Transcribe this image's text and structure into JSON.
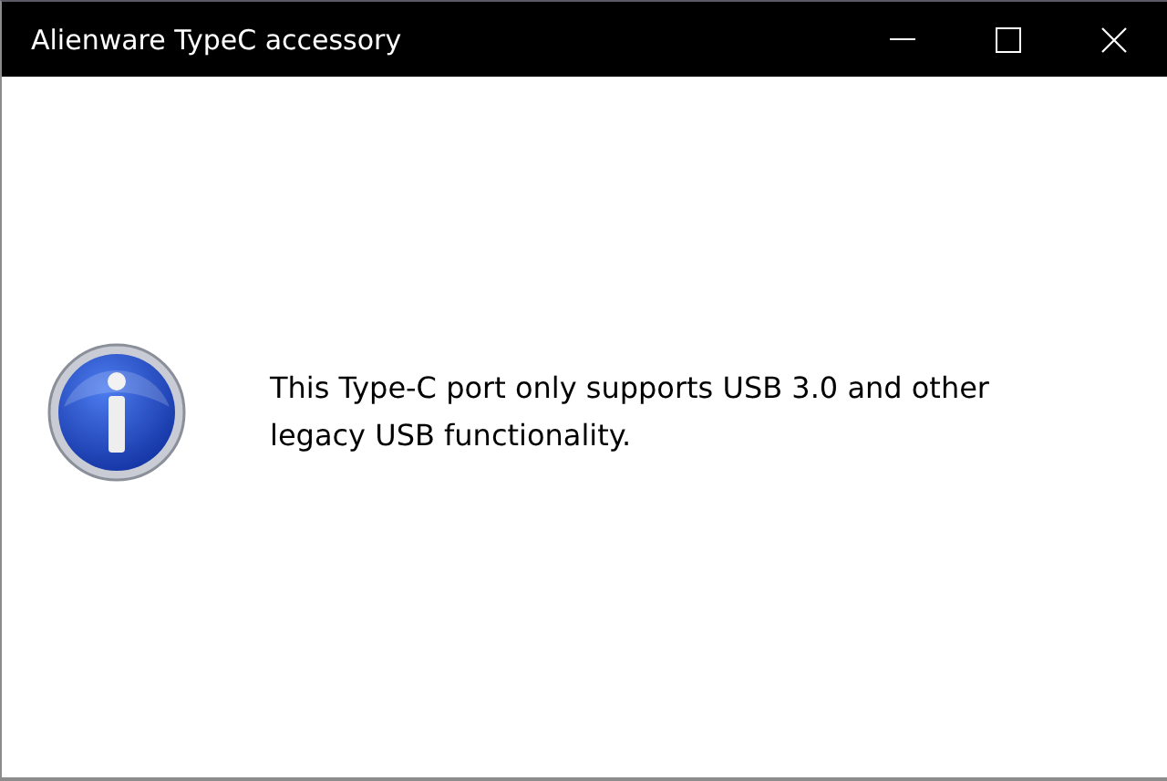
{
  "window": {
    "title": "Alienware TypeC accessory"
  },
  "message": "This Type-C port only supports USB 3.0 and other legacy USB functionality."
}
